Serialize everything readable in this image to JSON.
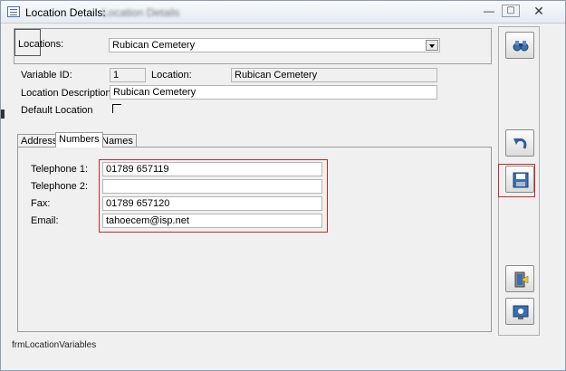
{
  "window": {
    "title": "Location Details:",
    "title_suffix": "Location Details",
    "minimize": "—",
    "maximize": "▢",
    "close": "✕"
  },
  "header": {
    "locations_label": "Locations:",
    "locations_value": "Rubican Cemetery"
  },
  "details": {
    "variable_id_label": "Variable ID:",
    "variable_id_value": "1",
    "location_label": "Location:",
    "location_value": "Rubican Cemetery",
    "description_label": "Location Description:",
    "description_value": "Rubican Cemetery",
    "default_location_label": "Default Location",
    "default_location_checked": false
  },
  "tabs": [
    {
      "label": "Address",
      "active": false
    },
    {
      "label": "Numbers",
      "active": true
    },
    {
      "label": "Names",
      "active": false
    }
  ],
  "numbers": {
    "telephone1_label": "Telephone 1:",
    "telephone1_value": "01789 657119",
    "telephone2_label": "Telephone 2:",
    "telephone2_value": "",
    "fax_label": "Fax:",
    "fax_value": "01789 657120",
    "email_label": "Email:",
    "email_value": "tahoecem@isp.net"
  },
  "toolbar": {
    "buttons": [
      {
        "icon": "binoculars-icon"
      },
      {
        "icon": "undo-icon"
      },
      {
        "icon": "save-icon",
        "highlighted": true
      },
      {
        "icon": "exit-door-icon"
      },
      {
        "icon": "help-icon"
      }
    ]
  },
  "footer": {
    "form_name": "frmLocationVariables"
  },
  "colors": {
    "highlight_border": "#c8252b",
    "title_bar": "#e6ebf2",
    "panel_bg": "#f0f0f0"
  }
}
